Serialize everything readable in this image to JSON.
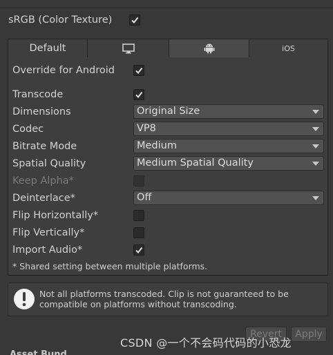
{
  "srgb": {
    "label": "sRGB (Color Texture)",
    "checked": true
  },
  "tabs": [
    {
      "label": "Default",
      "icon": ""
    },
    {
      "label": "",
      "icon": "monitor-icon"
    },
    {
      "label": "",
      "icon": "android-icon"
    },
    {
      "label": "iOS",
      "icon": ""
    }
  ],
  "settings": {
    "override": {
      "label": "Override for Android",
      "checked": true
    },
    "transcode": {
      "label": "Transcode",
      "checked": true
    },
    "dimensions": {
      "label": "Dimensions",
      "value": "Original Size"
    },
    "codec": {
      "label": "Codec",
      "value": "VP8"
    },
    "bitrate_mode": {
      "label": "Bitrate Mode",
      "value": "Medium"
    },
    "spatial_quality": {
      "label": "Spatial Quality",
      "value": "Medium Spatial Quality"
    },
    "keep_alpha": {
      "label": "Keep Alpha*",
      "checked": false,
      "disabled": true
    },
    "deinterlace": {
      "label": "Deinterlace*",
      "value": "Off"
    },
    "flip_h": {
      "label": "Flip Horizontally*",
      "checked": false
    },
    "flip_v": {
      "label": "Flip Vertically*",
      "checked": false
    },
    "import_audio": {
      "label": "Import Audio*",
      "checked": true
    }
  },
  "footnote": "* Shared setting between multiple platforms.",
  "help_message": "Not all platforms transcoded. Clip is not guaranteed to be compatible on platforms without transcoding.",
  "buttons": {
    "revert": "Revert",
    "apply": "Apply"
  },
  "asset_header": "Asset Bund",
  "watermark": "CSDN @一个不会码代码的小恐龙",
  "colors": {
    "background": "#383838",
    "panel": "#3e3e3e",
    "active_tab": "#4a4a4a",
    "dropdown": "#515151"
  }
}
